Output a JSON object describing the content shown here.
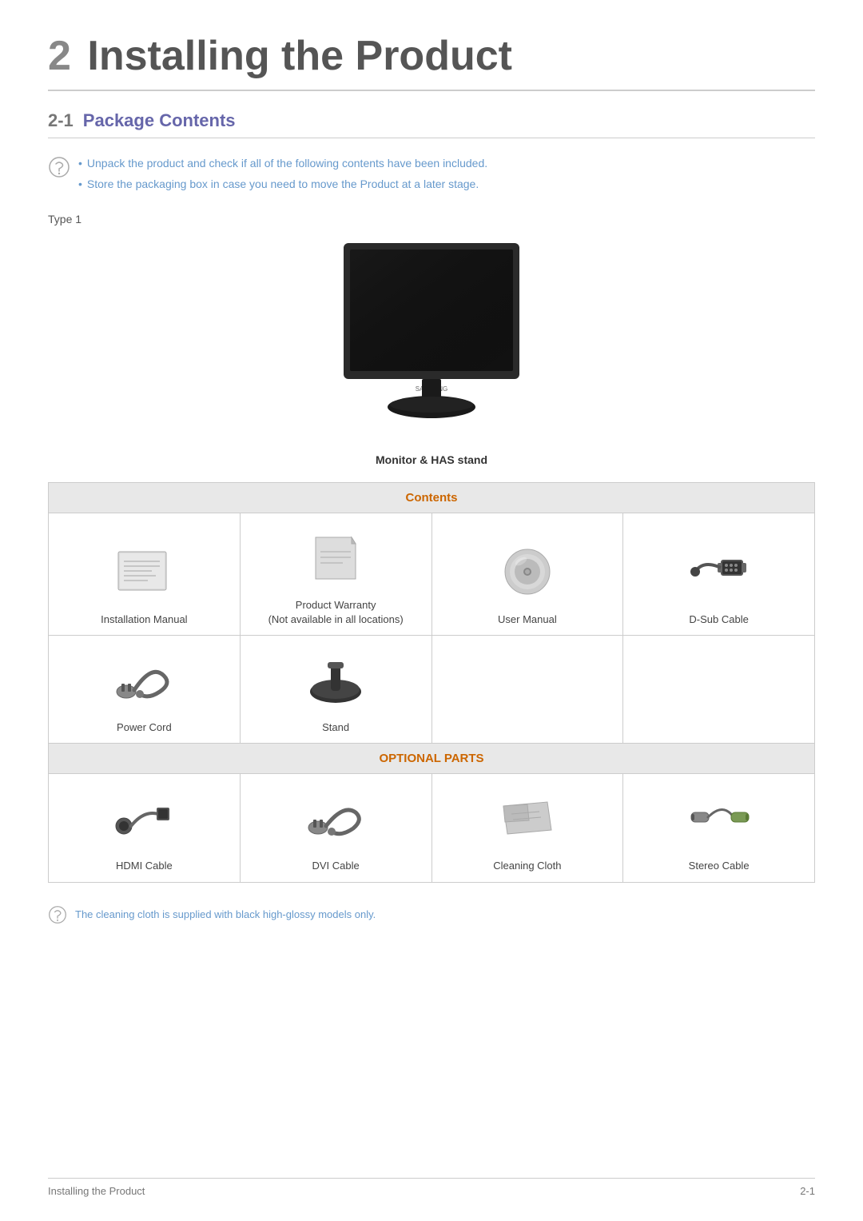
{
  "chapter": {
    "number": "2",
    "title": "Installing the Product"
  },
  "section": {
    "number": "2-1",
    "title": "Package Contents"
  },
  "notes": {
    "bullet1": "Unpack the product and check if all of the following contents have been included.",
    "bullet2": "Store the packaging box in case you need to move the Product at a later stage."
  },
  "type_label": "Type 1",
  "monitor_caption": "Monitor & HAS stand",
  "contents_header": "Contents",
  "optional_header": "OPTIONAL PARTS",
  "contents_items": [
    {
      "label": "Installation Manual",
      "type": "contents"
    },
    {
      "label": "Product Warranty\n(Not available in all locations)",
      "type": "contents"
    },
    {
      "label": "User Manual",
      "type": "contents"
    },
    {
      "label": "D-Sub Cable",
      "type": "contents"
    },
    {
      "label": "Power Cord",
      "type": "contents"
    },
    {
      "label": "Stand",
      "type": "contents"
    }
  ],
  "optional_items": [
    {
      "label": "HDMI Cable",
      "type": "optional"
    },
    {
      "label": "DVI Cable",
      "type": "optional"
    },
    {
      "label": "Cleaning Cloth",
      "type": "optional"
    },
    {
      "label": "Stereo Cable",
      "type": "optional"
    }
  ],
  "footer_note": "The cleaning cloth is supplied with black high-glossy models only.",
  "footer": {
    "left": "Installing the Product",
    "right": "2-1"
  }
}
